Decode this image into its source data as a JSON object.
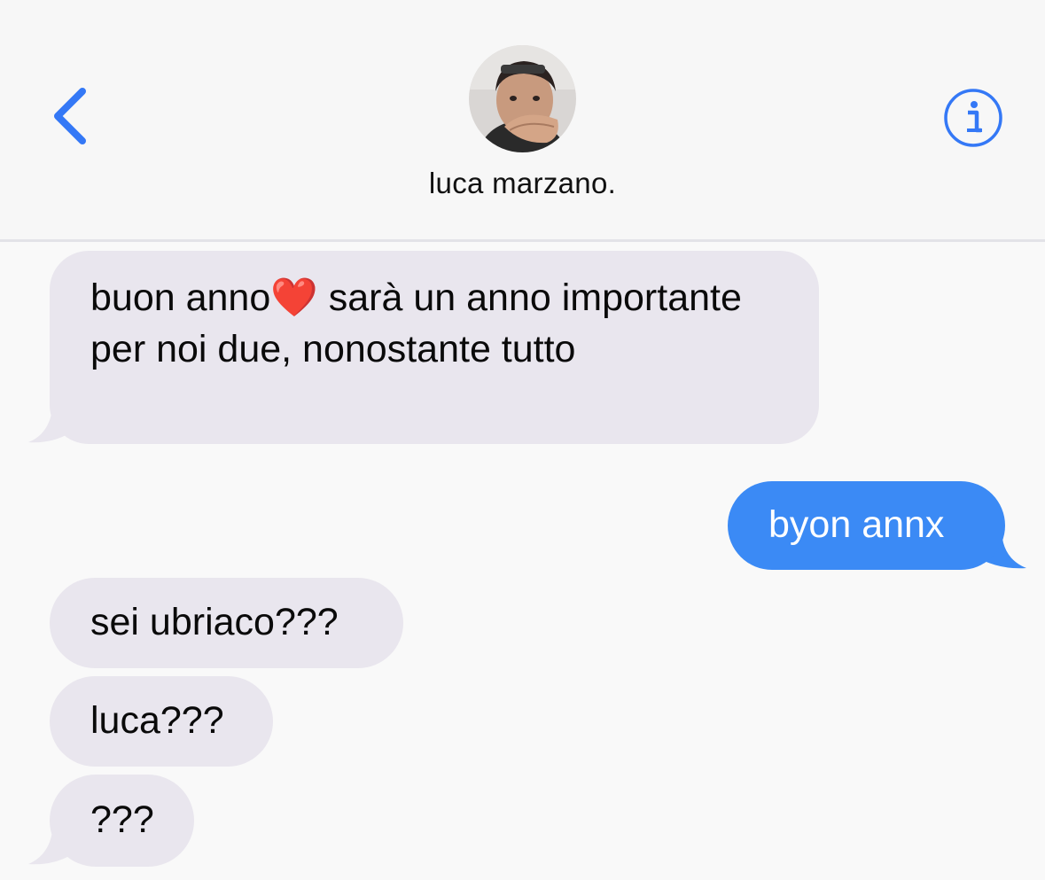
{
  "header": {
    "contact_name": "luca marzano.",
    "back_icon": "chevron-left-icon",
    "info_icon": "info-circle-icon",
    "accent_color": "#3478f6"
  },
  "messages": [
    {
      "direction": "incoming",
      "text": "buon anno❤️  sarà un anno importante per noi due, nonostante tutto"
    },
    {
      "direction": "outgoing",
      "text": "byon annx"
    },
    {
      "direction": "incoming",
      "text": "sei ubriaco???"
    },
    {
      "direction": "incoming",
      "text": "luca???"
    },
    {
      "direction": "incoming",
      "text": "???"
    }
  ],
  "colors": {
    "incoming_bubble": "#e9e6ee",
    "outgoing_bubble": "#3b8af5",
    "background": "#f9f9f9"
  }
}
